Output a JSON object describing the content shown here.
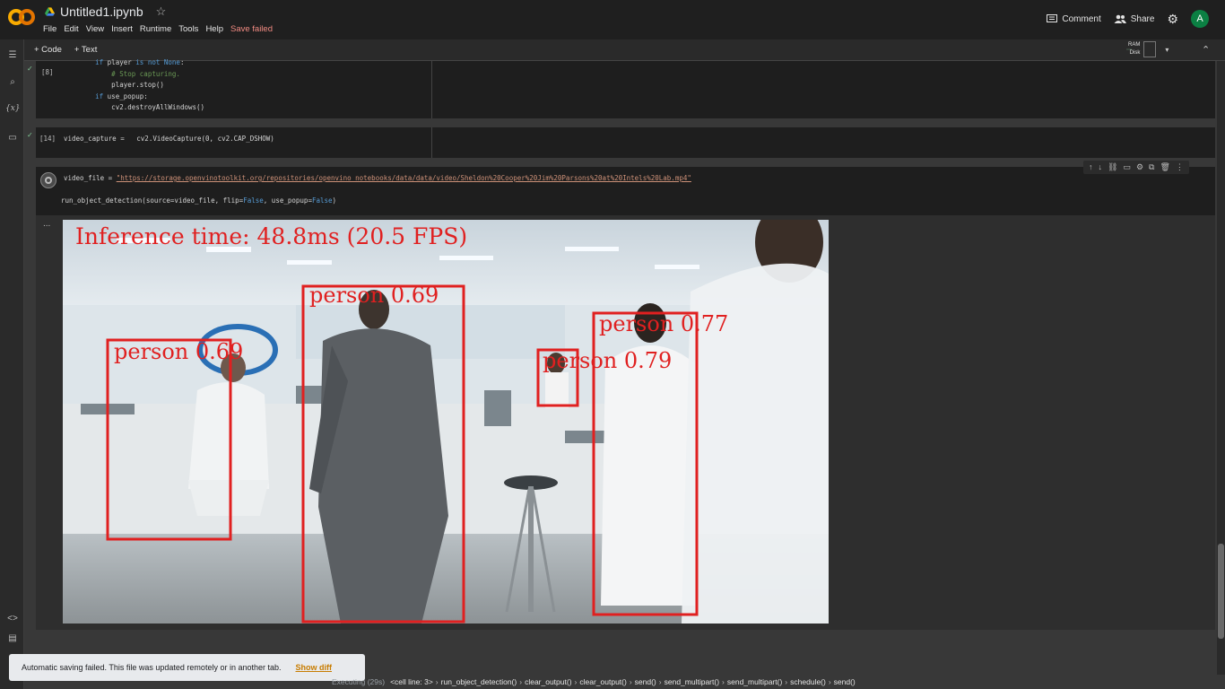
{
  "header": {
    "file_title": "Untitled1.ipynb",
    "menu": [
      "File",
      "Edit",
      "View",
      "Insert",
      "Runtime",
      "Tools",
      "Help"
    ],
    "save_status": "Save failed",
    "comment_label": "Comment",
    "share_label": "Share",
    "avatar_initial": "A"
  },
  "toolbar": {
    "add_code_label": "+ Code",
    "add_text_label": "+ Text",
    "ram_label": "RAM",
    "disk_label": "Disk"
  },
  "cells": {
    "cell8": {
      "exec_count": "[8]",
      "lines": [
        "        if player is not None:",
        "            # Stop capturing.",
        "            player.stop()",
        "        if use_popup:",
        "            cv2.destroyAllWindows()"
      ]
    },
    "cell14": {
      "exec_count": "[14]",
      "code": "video_capture =   cv2.VideoCapture(0, cv2.CAP_DSHOW)"
    },
    "running": {
      "line1_prefix": "video_file = ",
      "line1_url": "\"https://storage.openvinotoolkit.org/repositories/openvino_notebooks/data/data/video/Sheldon%20Cooper%20Jim%20Parsons%20at%20Intels%20Lab.mp4\"",
      "line2_func": "run_object_detection(source=video_file, flip=",
      "line2_false1": "False",
      "line2_mid": ", use_popup=",
      "line2_false2": "False",
      "line2_end": ")"
    }
  },
  "output": {
    "ellipsis": "...",
    "inference_text": "Inference time: 48.8ms (20.5 FPS)",
    "detections": [
      {
        "label": "person 0.69",
        "id": "d1"
      },
      {
        "label": "person 0.69",
        "id": "d2"
      },
      {
        "label": "person 0.79",
        "id": "d3"
      },
      {
        "label": "person 0.77",
        "id": "d4"
      }
    ]
  },
  "toast": {
    "message": "Automatic saving failed. This file was updated remotely or in another tab.",
    "action": "Show diff"
  },
  "statusbar": {
    "executing": "Executing (29s)",
    "crumbs": [
      "<cell line: 3>",
      "run_object_detection()",
      "clear_output()",
      "clear_output()",
      "send()",
      "send_multipart()",
      "send_multipart()",
      "schedule()",
      "send()"
    ]
  },
  "colors": {
    "detection_box": "#e02020",
    "warning": "#f28b82",
    "toast_action": "#c77c00"
  }
}
